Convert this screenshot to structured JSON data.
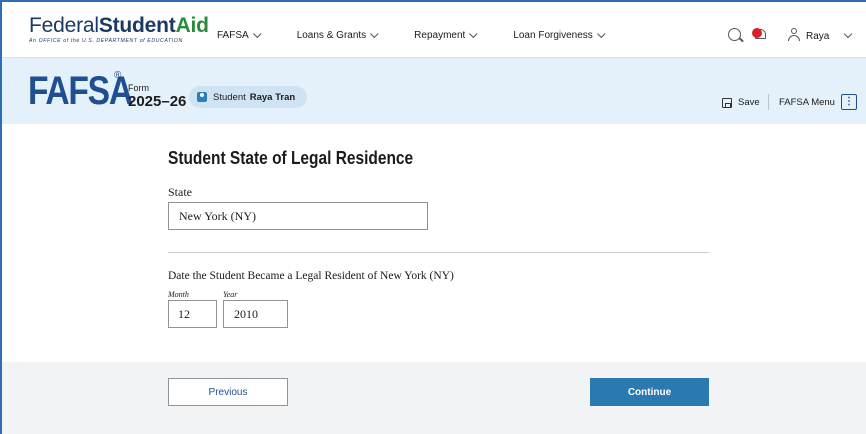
{
  "header": {
    "logo": {
      "federal": "Federal",
      "student": "Student",
      "aid": "Aid",
      "subtitle": "An OFFICE of the U.S. DEPARTMENT of EDUCATION"
    },
    "nav": [
      {
        "label": "FAFSA"
      },
      {
        "label": "Loans & Grants"
      },
      {
        "label": "Repayment"
      },
      {
        "label": "Loan Forgiveness"
      }
    ],
    "user_name": "Raya",
    "icons": [
      "search-icon",
      "notification-bell-icon",
      "user-icon",
      "chevron-down-icon"
    ]
  },
  "band": {
    "fafsa_logo": "FAFSA",
    "reg_mark": "®",
    "form_label": "Form",
    "form_year": "2025–26",
    "student_role": "Student",
    "student_name": "Raya Tran",
    "save_label": "Save",
    "menu_label": "FAFSA Menu",
    "menu_icon": "⋮"
  },
  "main": {
    "title": "Student State of Legal Residence",
    "state_label": "State",
    "state_value": "New York (NY)",
    "date_question": "Date the Student Became a Legal Resident of New York (NY)",
    "month_label": "Month",
    "year_label": "Year",
    "month_value": "12",
    "year_value": "2010"
  },
  "footer": {
    "previous_label": "Previous",
    "continue_label": "Continue"
  },
  "colors": {
    "brand_navy": "#1b3a63",
    "aid_green": "#2a8a3c",
    "fafsa_blue": "#1f4e91",
    "band_bg": "#e4f1fa",
    "continue_bg": "#2a79b0",
    "notification_red": "#d92027"
  }
}
